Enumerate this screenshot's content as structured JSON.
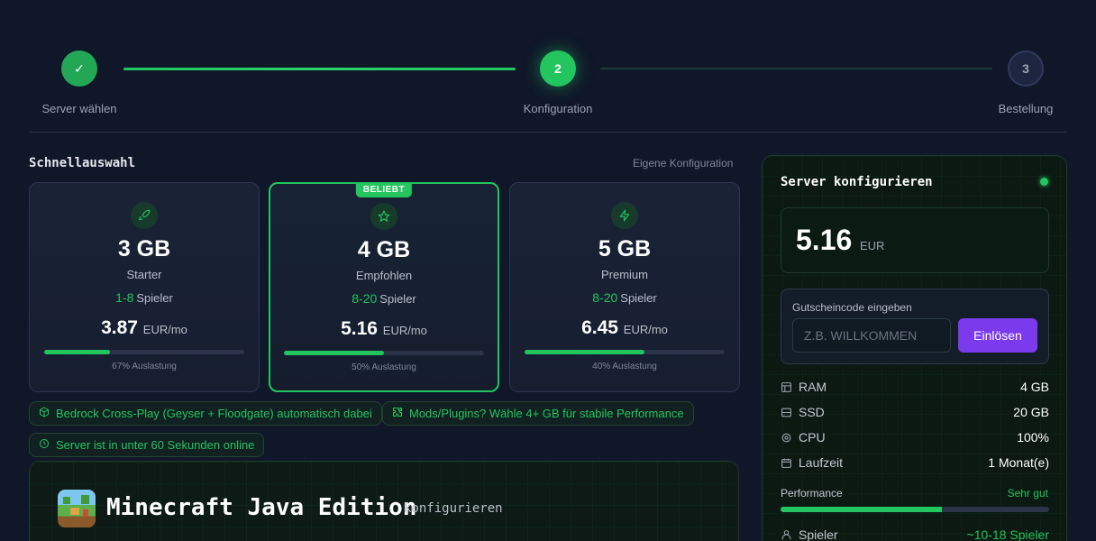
{
  "stepper": {
    "steps": [
      {
        "label": "Server wählen",
        "mark": "✓"
      },
      {
        "label": "Konfiguration",
        "mark": "2"
      },
      {
        "label": "Bestellung",
        "mark": "3"
      }
    ]
  },
  "quick_select": {
    "title": "Schnellauswahl",
    "own_config": "Eigene Konfiguration",
    "plans": [
      {
        "icon": "rocket-icon",
        "size": "3 GB",
        "tier": "Starter",
        "players_range": "1-8",
        "players_label": "Spieler",
        "price": "3.87",
        "price_unit": "EUR/mo",
        "load_text": "67% Auslastung",
        "load_fraction": 0.33
      },
      {
        "icon": "star-icon",
        "badge": "BELIEBT",
        "size": "4 GB",
        "tier": "Empfohlen",
        "players_range": "8-20",
        "players_label": "Spieler",
        "price": "5.16",
        "price_unit": "EUR/mo",
        "load_text": "50% Auslastung",
        "load_fraction": 0.5
      },
      {
        "icon": "bolt-icon",
        "size": "5 GB",
        "tier": "Premium",
        "players_range": "8-20",
        "players_label": "Spieler",
        "price": "6.45",
        "price_unit": "EUR/mo",
        "load_text": "40% Auslastung",
        "load_fraction": 0.6
      }
    ]
  },
  "chips": [
    {
      "icon": "cube-icon",
      "text": "Bedrock Cross-Play (Geyser + Floodgate) automatisch dabei"
    },
    {
      "icon": "puzzle-icon",
      "text": "Mods/Plugins? Wähle 4+ GB für stabile Performance"
    },
    {
      "icon": "clock-icon",
      "text": "Server ist in unter 60 Sekunden online"
    }
  ],
  "edition": {
    "title": "Minecraft Java Edition",
    "subtitle": "konfigurieren"
  },
  "panel": {
    "title": "Server konfigurieren",
    "price": "5.16",
    "currency": "EUR",
    "coupon": {
      "label": "Gutscheincode eingeben",
      "placeholder": "Z.B. WILLKOMMEN",
      "button": "Einlösen"
    },
    "specs": [
      {
        "icon": "ram-icon",
        "key": "RAM",
        "value": "4 GB"
      },
      {
        "icon": "ssd-icon",
        "key": "SSD",
        "value": "20 GB"
      },
      {
        "icon": "cpu-icon",
        "key": "CPU",
        "value": "100%"
      },
      {
        "icon": "calendar-icon",
        "key": "Laufzeit",
        "value": "1 Monat(e)"
      }
    ],
    "performance": {
      "label": "Performance",
      "value": "Sehr gut",
      "fraction": 0.6
    },
    "players": {
      "icon": "users-icon",
      "key": "Spieler",
      "value": "~10-18 Spieler"
    }
  },
  "colors": {
    "accent": "#22c55e",
    "button": "#7c3aed",
    "background": "#0f1729"
  }
}
